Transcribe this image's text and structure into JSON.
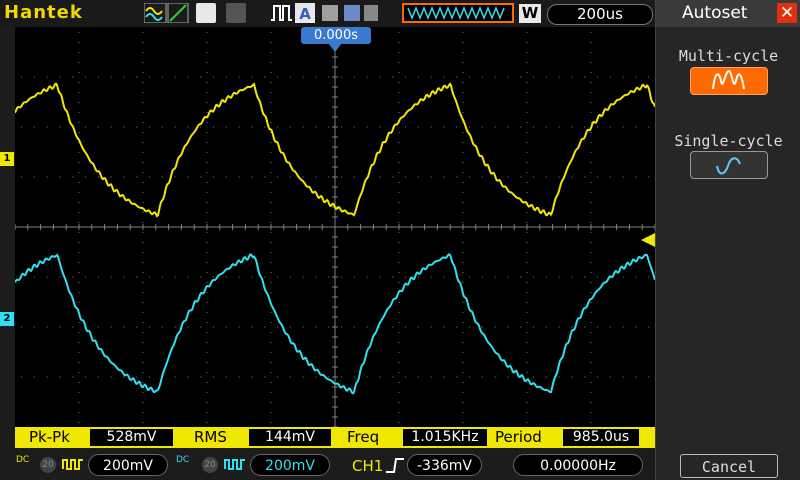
{
  "toolbar": {
    "brand": "Hantek",
    "timebase_mode": "W",
    "timebase": "200us"
  },
  "screen": {
    "trigger_position": "0.000s",
    "ch1_marker": "1",
    "ch2_marker": "2"
  },
  "measurements": [
    {
      "label": "Pk-Pk",
      "value": "528mV"
    },
    {
      "label": "RMS",
      "value": "144mV"
    },
    {
      "label": "Freq",
      "value": "1.015KHz"
    },
    {
      "label": "Period",
      "value": "985.0us"
    }
  ],
  "status": {
    "ch1_coupling": "DC",
    "ch1_bw": "20",
    "ch1_scale": "200mV",
    "ch2_coupling": "DC",
    "ch2_bw": "20",
    "ch2_scale": "200mV",
    "trigger_source": "CH1",
    "trigger_level": "-336mV",
    "trigger_freq": "0.00000Hz"
  },
  "autoset_panel": {
    "title": "Autoset",
    "multi_cycle_label": "Multi-cycle",
    "single_cycle_label": "Single-cycle",
    "cancel_label": "Cancel"
  },
  "colors": {
    "ch1": "#f0e800",
    "ch2": "#30e0f0",
    "accent": "#ff6a00",
    "grid": "#808080"
  }
}
